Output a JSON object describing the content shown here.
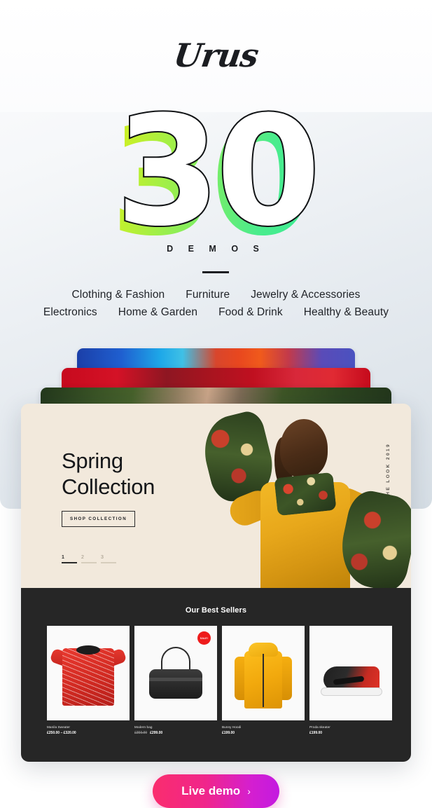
{
  "brand": {
    "logo_text": "Urus"
  },
  "hero": {
    "count": "30",
    "label": "D E M O S"
  },
  "categories": {
    "row1": [
      "Clothing & Fashion",
      "Furniture",
      "Jewelry & Accessories"
    ],
    "row2": [
      "Electronics",
      "Home & Garden",
      "Food & Drink",
      "Healthy & Beauty"
    ]
  },
  "demo_card": {
    "hero": {
      "title_line1": "Spring",
      "title_line2": "Collection",
      "cta": "SHOP COLLECTION",
      "vertical_label": "THE LOOK 2019",
      "pagination": [
        {
          "num": "1",
          "active": true
        },
        {
          "num": "2",
          "active": false
        },
        {
          "num": "3",
          "active": false
        }
      ]
    },
    "sellers": {
      "title": "Our Best Sellers",
      "products": [
        {
          "name": "Manila Sweater",
          "price": "£250.00 – £320.00",
          "old_price": "",
          "sale": false
        },
        {
          "name": "Modern bag",
          "price": "£299.00",
          "old_price": "£350.00",
          "sale": true,
          "badge": "SALE!"
        },
        {
          "name": "Bunny Hoodi",
          "price": "£199.00",
          "old_price": "",
          "sale": false
        },
        {
          "name": "Proda skeater",
          "price": "£199.00",
          "old_price": "",
          "sale": false
        }
      ]
    }
  },
  "footer": {
    "live_demo_label": "Live demo",
    "chevron": "›"
  },
  "colors": {
    "page_bg": "#ffffff",
    "panel_bg": "#d7dfe6",
    "card_cream": "#f2e9dc",
    "sellers_dark": "#262626",
    "accent_pink": "#fa2d6e",
    "accent_purple": "#c31ae0",
    "sale_red": "#ee1b1b",
    "shadow_yellow": "#e3f216",
    "shadow_green": "#18e9a8"
  }
}
